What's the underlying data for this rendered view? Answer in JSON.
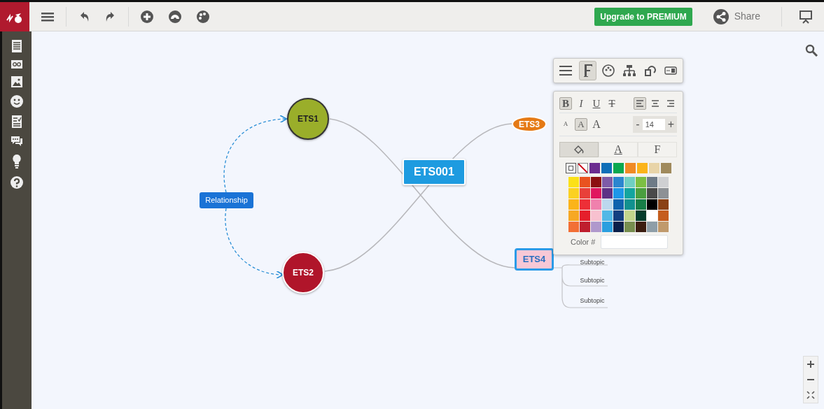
{
  "toolbar": {
    "upgrade_button": "Upgrade to PREMIUM",
    "share_button": "Share"
  },
  "map": {
    "center": "ETS001",
    "topics": [
      {
        "label": "ETS1",
        "kind": "circle",
        "color": "#9aae2a"
      },
      {
        "label": "ETS2",
        "kind": "circle",
        "color": "#b0152a"
      },
      {
        "label": "ETS3",
        "kind": "oval",
        "color": "#e57a16"
      },
      {
        "label": "ETS4",
        "kind": "box",
        "color": "#f8c8d6",
        "selected": true
      }
    ],
    "relationship": "Relationship",
    "subtopics": [
      "Subtopic",
      "Subtopic",
      "Subtopic"
    ]
  },
  "format_panel": {
    "tabs": [
      {
        "selected": false
      },
      {
        "selected": true
      },
      {
        "selected": false
      },
      {
        "selected": false
      },
      {
        "selected": false
      },
      {
        "selected": false
      }
    ],
    "styles": [
      {
        "label": "B",
        "kind": "bold",
        "selected": true
      },
      {
        "label": "I",
        "kind": "italic",
        "selected": false
      },
      {
        "label": "U",
        "kind": "underline",
        "selected": false
      },
      {
        "label": "T",
        "kind": "strike",
        "selected": false
      }
    ],
    "align": [
      {
        "selected": true
      },
      {
        "selected": false
      },
      {
        "selected": false
      }
    ],
    "sizes": [
      {
        "label": "A",
        "selected": false
      },
      {
        "label": "A",
        "selected": true
      },
      {
        "label": "A",
        "selected": false
      }
    ],
    "size_minus": "-",
    "size_value": "14",
    "size_plus": "+",
    "color_tabs": [
      {
        "kind": "fill",
        "selected": true
      },
      {
        "kind": "text",
        "label": "A",
        "selected": false
      },
      {
        "kind": "font",
        "label": "F",
        "selected": false
      }
    ],
    "top_colors": [
      {
        "kind": "transparent"
      },
      {
        "kind": "none"
      },
      {
        "color": "#6b2d90"
      },
      {
        "color": "#0f6fb8"
      },
      {
        "color": "#0aa84f"
      },
      {
        "color": "#f08a24"
      },
      {
        "color": "#fbb41a"
      },
      {
        "color": "#e8d4a8"
      },
      {
        "color": "#a08a5c"
      }
    ],
    "palette": [
      [
        {
          "color": "#fbe118"
        },
        {
          "color": "#e9531f"
        },
        {
          "color": "#8b1010"
        },
        {
          "color": "#7e5ba8"
        },
        {
          "color": "#2b86cf"
        },
        {
          "color": "#6fcfc3"
        },
        {
          "color": "#7cbf44"
        },
        {
          "color": "#6e7b87"
        },
        {
          "color": "#cfd0d2"
        }
      ],
      [
        {
          "color": "#fbd121"
        },
        {
          "color": "#e8403a"
        },
        {
          "color": "#e0185f"
        },
        {
          "color": "#5e3285"
        },
        {
          "color": "#1e97e8"
        },
        {
          "color": "#13a59f"
        },
        {
          "color": "#4a9f3f"
        },
        {
          "color": "#4a4a4a"
        },
        {
          "color": "#8d9195"
        }
      ],
      [
        {
          "color": "#fbb41a"
        },
        {
          "color": "#ed2f37"
        },
        {
          "color": "#f081ad"
        },
        {
          "color": "#bcd8ee"
        },
        {
          "color": "#0f62ad"
        },
        {
          "color": "#11918f"
        },
        {
          "color": "#177e47"
        },
        {
          "color": "#000000"
        },
        {
          "color": "#8a4216"
        }
      ],
      [
        {
          "color": "#f7a823"
        },
        {
          "color": "#e51f2b"
        },
        {
          "color": "#f7c1cf"
        },
        {
          "color": "#52b8e6"
        },
        {
          "color": "#133f80"
        },
        {
          "color": "#c2d48c"
        },
        {
          "color": "#063c2c"
        },
        {
          "color": "#ffffff"
        },
        {
          "color": "#c55d1e"
        }
      ],
      [
        {
          "color": "#f26f35"
        },
        {
          "color": "#bf1e2e"
        },
        {
          "color": "#b098cc"
        },
        {
          "color": "#2b9fdf"
        },
        {
          "color": "#0a1f4a"
        },
        {
          "color": "#778e4f"
        },
        {
          "color": "#3b1d10"
        },
        {
          "color": "#8e9ea8"
        },
        {
          "color": "#c09a6c"
        }
      ]
    ],
    "color_label": "Color #"
  }
}
